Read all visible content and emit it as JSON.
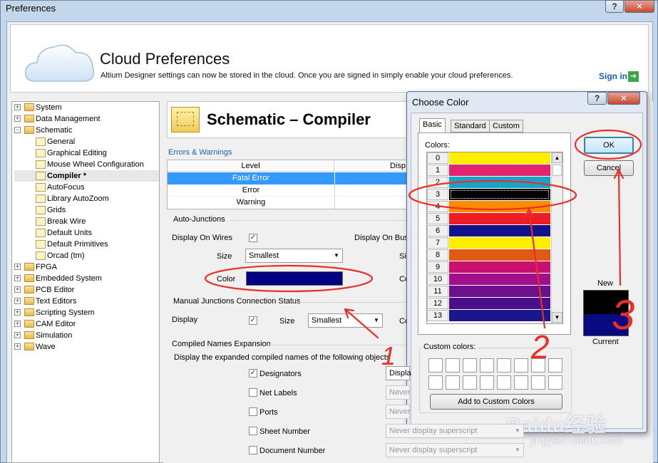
{
  "window": {
    "title": "Preferences"
  },
  "cloud": {
    "title": "Cloud Preferences",
    "description": "Altium Designer settings can now be stored in the cloud. Once you are signed in simply enable your cloud preferences.",
    "signin": "Sign in"
  },
  "tree": {
    "items": [
      {
        "label": "System",
        "toggle": "+",
        "indent": 0
      },
      {
        "label": "Data Management",
        "toggle": "+",
        "indent": 0
      },
      {
        "label": "Schematic",
        "toggle": "-",
        "indent": 0
      },
      {
        "label": "General",
        "toggle": "",
        "indent": 1
      },
      {
        "label": "Graphical Editing",
        "toggle": "",
        "indent": 1
      },
      {
        "label": "Mouse Wheel Configuration",
        "toggle": "",
        "indent": 1
      },
      {
        "label": "Compiler *",
        "toggle": "",
        "indent": 1,
        "selected": true
      },
      {
        "label": "AutoFocus",
        "toggle": "",
        "indent": 1
      },
      {
        "label": "Library AutoZoom",
        "toggle": "",
        "indent": 1
      },
      {
        "label": "Grids",
        "toggle": "",
        "indent": 1
      },
      {
        "label": "Break Wire",
        "toggle": "",
        "indent": 1
      },
      {
        "label": "Default Units",
        "toggle": "",
        "indent": 1
      },
      {
        "label": "Default Primitives",
        "toggle": "",
        "indent": 1
      },
      {
        "label": "Orcad (tm)",
        "toggle": "",
        "indent": 1
      },
      {
        "label": "FPGA",
        "toggle": "+",
        "indent": 0
      },
      {
        "label": "Embedded System",
        "toggle": "+",
        "indent": 0
      },
      {
        "label": "PCB Editor",
        "toggle": "+",
        "indent": 0
      },
      {
        "label": "Text Editors",
        "toggle": "+",
        "indent": 0
      },
      {
        "label": "Scripting System",
        "toggle": "+",
        "indent": 0
      },
      {
        "label": "CAM Editor",
        "toggle": "+",
        "indent": 0
      },
      {
        "label": "Simulation",
        "toggle": "+",
        "indent": 0
      },
      {
        "label": "Wave",
        "toggle": "+",
        "indent": 0
      }
    ]
  },
  "page": {
    "title": "Schematic – Compiler",
    "errors_warnings": {
      "label": "Errors & Warnings",
      "columns": [
        "Level",
        "Disp"
      ],
      "rows": [
        "Fatal Error",
        "Error",
        "Warning"
      ]
    },
    "auto_junctions": {
      "title": "Auto-Junctions",
      "display_on_wires": "Display On Wires",
      "display_on_buses": "Display On Buse",
      "size_label": "Size",
      "size_value": "Smallest",
      "color_label": "Color",
      "color_value": "#000080",
      "cut_si": "Si",
      "cut_co": "Co"
    },
    "manual_junctions": {
      "title": "Manual Junctions Connection Status",
      "display_label": "Display",
      "size_label": "Size",
      "size_value": "Smallest",
      "cut_co": "Co"
    },
    "compiled_names": {
      "title": "Compiled Names Expansion",
      "description": "Display the expanded compiled names of the following objects",
      "items": [
        {
          "label": "Designators",
          "checked": true,
          "combo": "Displa"
        },
        {
          "label": "Net Labels",
          "checked": false,
          "combo": "Never"
        },
        {
          "label": "Ports",
          "checked": false,
          "combo": "Never"
        },
        {
          "label": "Sheet Number",
          "checked": false,
          "combo": "Never display superscript"
        },
        {
          "label": "Document Number",
          "checked": false,
          "combo": "Never display superscript"
        }
      ]
    }
  },
  "color_dialog": {
    "title": "Choose Color",
    "tabs": [
      "Basic",
      "Standard",
      "Custom"
    ],
    "colors_label": "Colors:",
    "colors": [
      {
        "num": "0",
        "color": "#ffee00"
      },
      {
        "num": "1",
        "color": "#e0256e"
      },
      {
        "num": "2",
        "color": "#1aa3c9"
      },
      {
        "num": "3",
        "color": "#000000"
      },
      {
        "num": "4",
        "color": "#ff8a00"
      },
      {
        "num": "5",
        "color": "#ee1c24"
      },
      {
        "num": "6",
        "color": "#12128a"
      },
      {
        "num": "7",
        "color": "#ffee00"
      },
      {
        "num": "8",
        "color": "#e05a14"
      },
      {
        "num": "9",
        "color": "#c8106e"
      },
      {
        "num": "10",
        "color": "#a0108c"
      },
      {
        "num": "11",
        "color": "#6c108c"
      },
      {
        "num": "12",
        "color": "#4a108c"
      },
      {
        "num": "13",
        "color": "#1a168c"
      }
    ],
    "custom_label": "Custom colors:",
    "add_button": "Add to Custom Colors",
    "ok": "OK",
    "cancel": "Cancel",
    "new_label": "New",
    "current_label": "Current",
    "help": "?",
    "close": "✕"
  },
  "watermark": {
    "brand": "Baidu经验",
    "url": "jingyan.baidu.com"
  },
  "annotations": {
    "mark_1": "1",
    "mark_2": "2",
    "mark_3": "3"
  }
}
